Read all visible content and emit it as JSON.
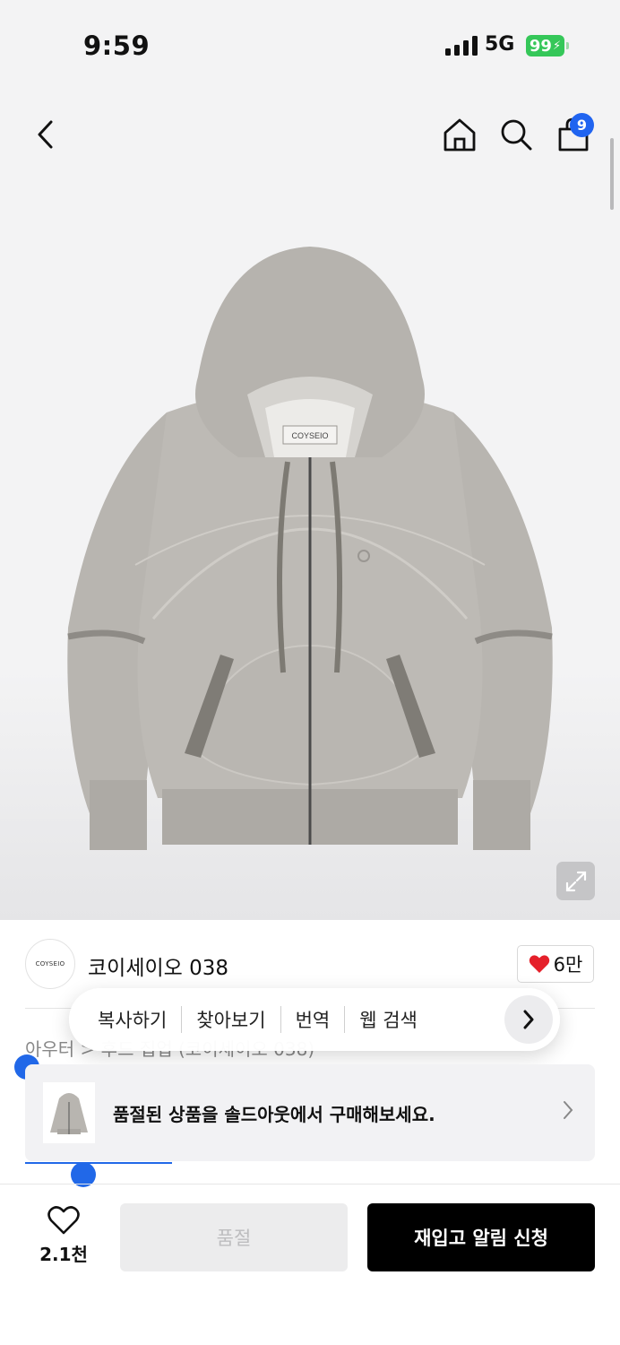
{
  "status_bar": {
    "time": "9:59",
    "network": "5G",
    "battery": "99"
  },
  "nav": {
    "cart_count": "9"
  },
  "product": {
    "label_text": "COYSEIO",
    "brand_logo_text": "COYSEIO",
    "brand_name": "코이세이오 038",
    "like_count": "6만",
    "breadcrumb": "아우터 > 후드 집업 (코이세이오 038)"
  },
  "context_menu": {
    "items": [
      "복사하기",
      "찾아보기",
      "번역",
      "웹 검색"
    ]
  },
  "soldout_banner": {
    "text": "품절된 상품을 솔드아웃에서 구매해보세요."
  },
  "bottom_bar": {
    "wish_count": "2.1천",
    "soldout_label": "품절",
    "restock_label": "재입고 알림 신청"
  },
  "colors": {
    "accent_blue": "#2064f0",
    "battery_green": "#35c759",
    "heart_red": "#e5202a"
  }
}
